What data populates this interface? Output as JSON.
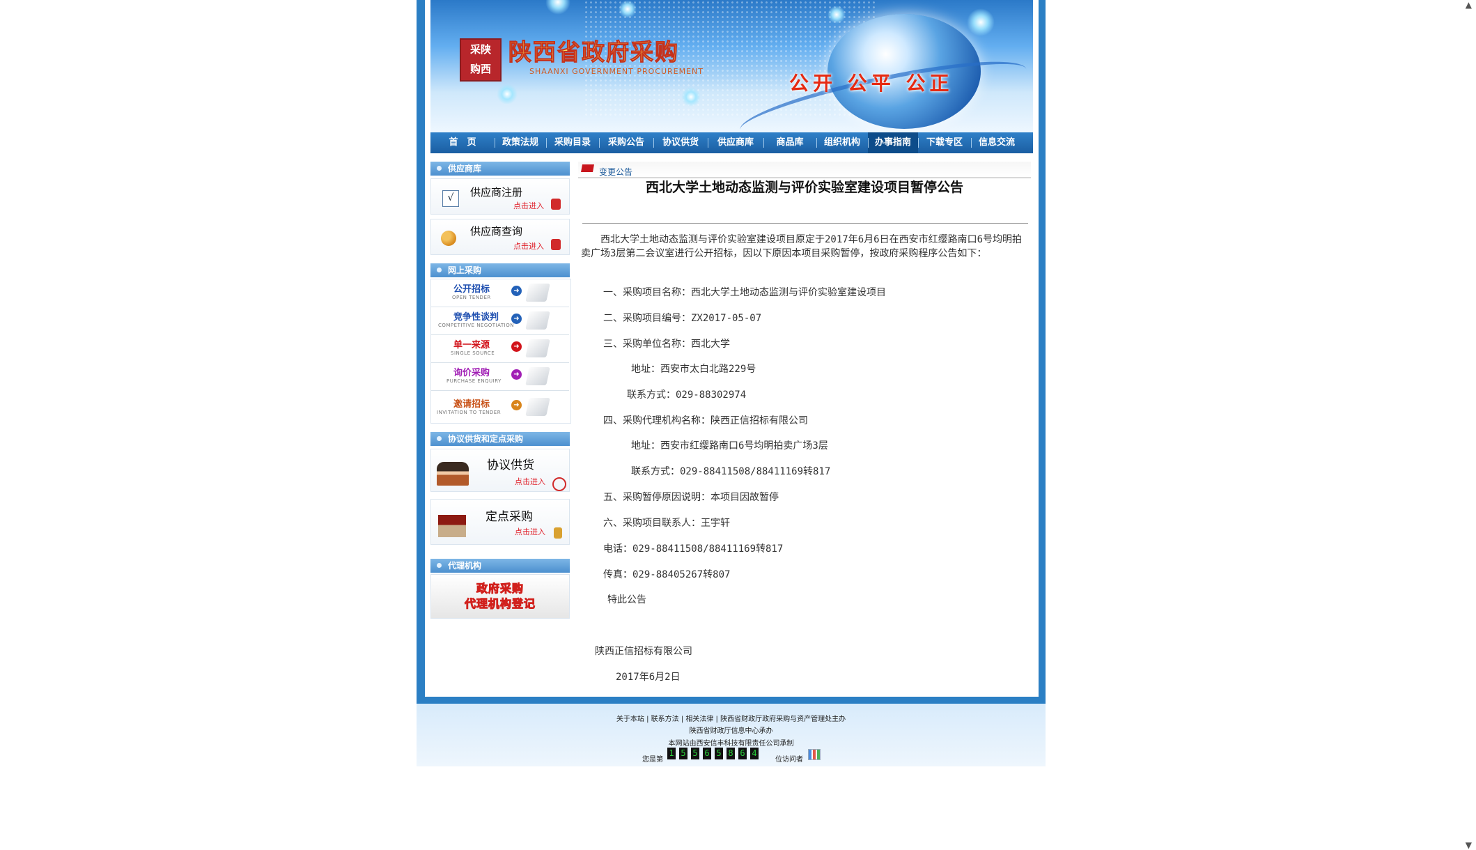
{
  "header": {
    "site_title": "陕西省政府采购",
    "site_subtitle": "SHAANXI GOVERNMENT PROCUREMENT",
    "seal_text": "采陕购西",
    "slogan": "公开 公平 公正"
  },
  "nav": {
    "items": [
      "首　页",
      "政策法规",
      "采购目录",
      "采购公告",
      "协议供货",
      "供应商库",
      "商品库",
      "组织机构",
      "办事指南",
      "下载专区",
      "信息交流"
    ],
    "active": "办事指南"
  },
  "sidebar": {
    "supplier_head": "供应商库",
    "supplier_register": "供应商注册",
    "supplier_query": "供应商查询",
    "click_enter": "点击进入",
    "online_head": "网上采购",
    "tenders": [
      {
        "cn": "公开招标",
        "en": "OPEN TENDER",
        "color": "#1f4fb0"
      },
      {
        "cn": "竞争性谈判",
        "en": "COMPETITIVE NEGOTIATION",
        "color": "#1f4fb0"
      },
      {
        "cn": "单一来源",
        "en": "SINGLE SOURCE",
        "color": "#d2141b"
      },
      {
        "cn": "询价采购",
        "en": "PURCHASE ENQUIRY",
        "color": "#a11fb5"
      },
      {
        "cn": "邀请招标",
        "en": "INVITATION TO TENDER",
        "color": "#c9541a"
      }
    ],
    "agreement_head": "协议供货和定点采购",
    "agreement_supply": "协议供货",
    "fixed_purchase": "定点采购",
    "agency_head": "代理机构",
    "agency_banner_1": "政府采购",
    "agency_banner_2": "代理机构登记"
  },
  "article": {
    "tab_label": "变更公告",
    "title": "西北大学土地动态监测与评价实验室建设项目暂停公告",
    "intro": "西北大学土地动态监测与评价实验室建设项目原定于2017年6月6日在西安市红缨路南口6号均明拍卖广场3层第二会议室进行公开招标，因以下原因本项目采购暂停，按政府采购程序公告如下：",
    "lines": [
      "一、采购项目名称：西北大学土地动态监测与评价实验室建设项目",
      "二、采购项目编号：ZX2017-05-07",
      "三、采购单位名称：西北大学",
      "地址：西安市太白北路229号",
      "联系方式：029-88302974",
      "四、采购代理机构名称：陕西正信招标有限公司",
      "地址：西安市红缨路南口6号均明拍卖广场3层",
      "联系方式：029-88411508/88411169转817",
      "五、采购暂停原因说明：本项目因故暂停",
      "六、采购项目联系人：王宇轩",
      "电话：029-88411508/88411169转817",
      "传真：029-88405267转807",
      "特此公告",
      "陕西正信招标有限公司",
      "2017年6月2日"
    ]
  },
  "footer": {
    "link_about": "关于本站",
    "link_contact": "联系方法",
    "link_law": "相关法律",
    "sponsor": "陕西省财政厅政府采购与资产管理处主办",
    "organizer": "陕西省财政厅信息中心承办",
    "maker": "本网站由西安信丰科技有限责任公司承制",
    "visitor_prefix": "您是第",
    "visitor_count": "15565864",
    "visitor_suffix": "位访问者"
  },
  "colors": {
    "frame": "#2b7fc4",
    "nav": "#1b5ea2",
    "accent_red": "#c8161d"
  }
}
